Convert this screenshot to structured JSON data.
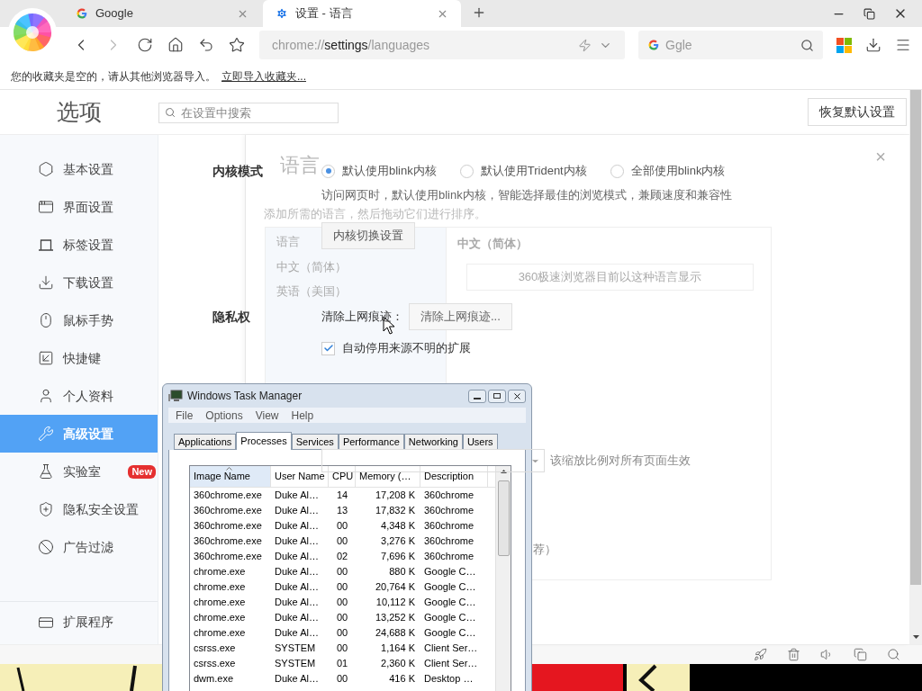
{
  "browser": {
    "tabs": [
      {
        "title": "Google",
        "selected": false
      },
      {
        "title": "设置 - 语言",
        "selected": true
      }
    ],
    "address": {
      "parts": [
        {
          "text": "chrome://",
          "strong": false
        },
        {
          "text": "settings",
          "strong": true
        },
        {
          "text": "/languages",
          "strong": false
        }
      ]
    },
    "search": {
      "value": "Ggle"
    },
    "bookmarks_bar": {
      "message": "您的收藏夹是空的，请从其他浏览器导入。",
      "link": "立即导入收藏夹..."
    }
  },
  "settings": {
    "title": "选项",
    "search_placeholder": "在设置中搜索",
    "reset_button": "恢复默认设置",
    "sidebar": {
      "items": [
        {
          "label": "基本设置",
          "selected": false
        },
        {
          "label": "界面设置",
          "selected": false
        },
        {
          "label": "标签设置",
          "selected": false
        },
        {
          "label": "下载设置",
          "selected": false
        },
        {
          "label": "鼠标手势",
          "selected": false
        },
        {
          "label": "快捷键",
          "selected": false
        },
        {
          "label": "个人资料",
          "selected": false
        },
        {
          "label": "高级设置",
          "selected": true
        },
        {
          "label": "实验室",
          "selected": false,
          "badge": "New"
        },
        {
          "label": "隐私安全设置",
          "selected": false
        },
        {
          "label": "广告过滤",
          "selected": false
        }
      ],
      "footer_item": {
        "label": "扩展程序"
      }
    },
    "kernel": {
      "label": "内核模式",
      "options": [
        {
          "label": "默认使用blink内核",
          "selected": true
        },
        {
          "label": "默认使用Trident内核",
          "selected": false
        },
        {
          "label": "全部使用blink内核",
          "selected": false
        }
      ],
      "description": "访问网页时，默认使用blink内核，智能选择最佳的浏览模式，兼顾速度和兼容性",
      "button": "内核切换设置"
    },
    "privacy": {
      "label": "隐私权",
      "clear_label": "清除上网痕迹：",
      "clear_button": "清除上网痕迹...",
      "checkbox": {
        "label": "自动停用来源不明的扩展",
        "checked": true
      }
    },
    "zoom_note": "该缩放比例对所有页面生效",
    "fragment": "荐）"
  },
  "language_dialog": {
    "title": "语言",
    "close": "×",
    "subtitle": "添加所需的语言，然后拖动它们进行排序。",
    "list_heading": "语言",
    "languages": [
      {
        "label": "中文（简体）"
      },
      {
        "label": "英语（美国）"
      }
    ],
    "detail_title": "中文（简体）",
    "detail_button": "360极速浏览器目前以这种语言显示"
  },
  "task_manager": {
    "title": "Windows Task Manager",
    "menu": [
      "File",
      "Options",
      "View",
      "Help"
    ],
    "tabs": [
      {
        "label": "Applications",
        "selected": false
      },
      {
        "label": "Processes",
        "selected": true
      },
      {
        "label": "Services",
        "selected": false
      },
      {
        "label": "Performance",
        "selected": false
      },
      {
        "label": "Networking",
        "selected": false
      },
      {
        "label": "Users",
        "selected": false
      }
    ],
    "columns": [
      {
        "label": "Image Name",
        "kind": "text",
        "sorted": true
      },
      {
        "label": "User Name",
        "kind": "text",
        "sorted": false
      },
      {
        "label": "CPU",
        "kind": "count",
        "sorted": false
      },
      {
        "label": "Memory (…",
        "kind": "number",
        "sorted": false
      },
      {
        "label": "Description",
        "kind": "text",
        "sorted": false
      }
    ],
    "rows": [
      [
        "360chrome.exe",
        "Duke Al…",
        "14",
        "17,208 K",
        "360chrome"
      ],
      [
        "360chrome.exe",
        "Duke Al…",
        "13",
        "17,832 K",
        "360chrome"
      ],
      [
        "360chrome.exe",
        "Duke Al…",
        "00",
        "4,348 K",
        "360chrome"
      ],
      [
        "360chrome.exe",
        "Duke Al…",
        "00",
        "3,276 K",
        "360chrome"
      ],
      [
        "360chrome.exe",
        "Duke Al…",
        "02",
        "7,696 K",
        "360chrome"
      ],
      [
        "chrome.exe",
        "Duke Al…",
        "00",
        "880 K",
        "Google C…"
      ],
      [
        "chrome.exe",
        "Duke Al…",
        "00",
        "20,764 K",
        "Google C…"
      ],
      [
        "chrome.exe",
        "Duke Al…",
        "00",
        "10,112 K",
        "Google C…"
      ],
      [
        "chrome.exe",
        "Duke Al…",
        "00",
        "13,252 K",
        "Google C…"
      ],
      [
        "chrome.exe",
        "Duke Al…",
        "00",
        "24,688 K",
        "Google C…"
      ],
      [
        "csrss.exe",
        "SYSTEM",
        "00",
        "1,164 K",
        "Client Ser…"
      ],
      [
        "csrss.exe",
        "SYSTEM",
        "01",
        "2,360 K",
        "Client Ser…"
      ],
      [
        "dwm.exe",
        "Duke Al…",
        "00",
        "416 K",
        "Desktop …"
      ]
    ]
  }
}
